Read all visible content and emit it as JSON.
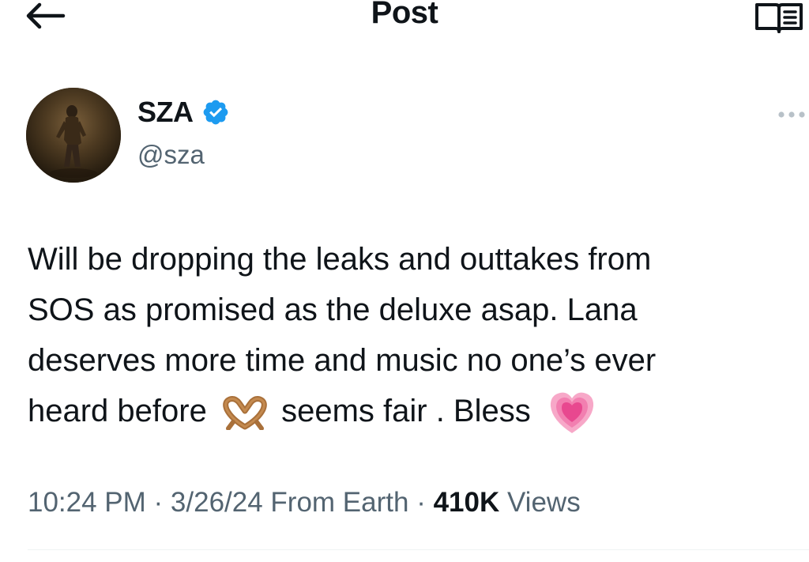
{
  "header": {
    "title": "Post",
    "back_icon": "arrow-left-icon",
    "reader_icon": "reader-mode-icon"
  },
  "author": {
    "name": "SZA",
    "handle": "@sza",
    "verified_icon": "verified-badge-icon",
    "verified_color": "#1d9bf0",
    "more_icon": "more-horizontal-icon"
  },
  "post": {
    "line1": "Will be dropping the leaks and outtakes from",
    "line2": "SOS as promised as the deluxe asap. Lana",
    "line3": "deserves more time and music no one’s ever",
    "line4a": "heard before",
    "heart_hands_emoji": "heart-hands-emoji",
    "line4b": "seems fair . Bless",
    "growing_heart_emoji": "growing-heart-emoji"
  },
  "meta": {
    "time": "10:24 PM",
    "sep1": " · ",
    "date": "3/26/24",
    "source": " From Earth",
    "sep2": " · ",
    "views_count": "410K",
    "views_label": " Views"
  },
  "colors": {
    "text_primary": "#0f1419",
    "text_secondary": "#536471",
    "accent": "#1d9bf0",
    "divider": "#eff3f4"
  }
}
